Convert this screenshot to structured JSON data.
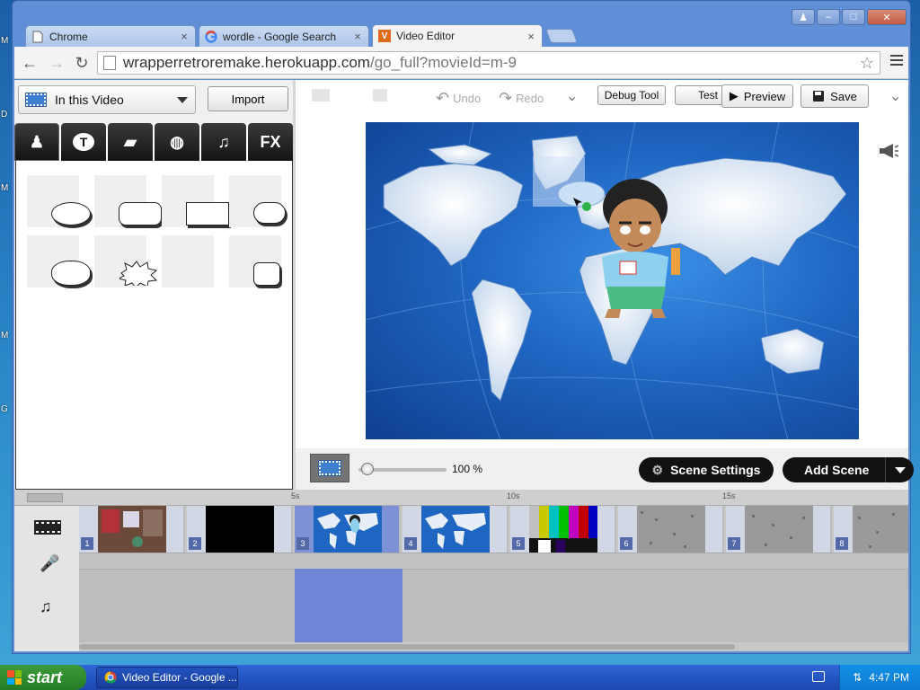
{
  "desktop": {
    "edge_letters": [
      "M",
      "D",
      "M",
      "M",
      "G"
    ]
  },
  "browser": {
    "tabs": [
      {
        "label": "Chrome",
        "icon": "page-icon",
        "active": false
      },
      {
        "label": "wordle - Google Search",
        "icon": "google-icon",
        "active": false
      },
      {
        "label": "Video Editor",
        "icon": "vyond-icon",
        "active": true
      }
    ],
    "tab_close": "×",
    "url_host": "wrapperretroremake.herokuapp.com",
    "url_rest": "/go_full?movieId=m-9",
    "window_buttons": {
      "user": "♟",
      "minimize": "–",
      "maximize": "□",
      "close": "✕"
    },
    "colors": {
      "frame": "#5f8fd6",
      "tab_active": "#f3f3f3"
    }
  },
  "editor": {
    "library_select": "In this Video",
    "import_label": "Import",
    "categories": [
      "character",
      "text",
      "prop",
      "sports",
      "music",
      "FX"
    ],
    "category_glyphs": {
      "text": "T",
      "music": "♫",
      "fx": "FX",
      "sports": "◍",
      "prop": "▰",
      "character": "♟"
    },
    "toolbar": {
      "undo": "Undo",
      "redo": "Redo",
      "debug": "Debug Tool",
      "test": "Test",
      "preview": "Preview",
      "save": "Save"
    },
    "zoom_level": "100 %",
    "zoom_fraction": 0.1,
    "scene_settings": "Scene Settings",
    "add_scene": "Add Scene"
  },
  "timeline": {
    "ticks": [
      "5s",
      "10s",
      "15s"
    ],
    "scenes": [
      {
        "number": "1",
        "thumb": "street"
      },
      {
        "number": "2",
        "thumb": "black"
      },
      {
        "number": "3",
        "thumb": "map-character",
        "selected": true
      },
      {
        "number": "4",
        "thumb": "map"
      },
      {
        "number": "5",
        "thumb": "color-bars"
      },
      {
        "number": "6",
        "thumb": "static"
      },
      {
        "number": "7",
        "thumb": "static"
      },
      {
        "number": "8",
        "thumb": "static"
      }
    ]
  },
  "taskbar": {
    "start": "start",
    "task_item": "Video Editor - Google ...",
    "clock": "4:47 PM"
  }
}
